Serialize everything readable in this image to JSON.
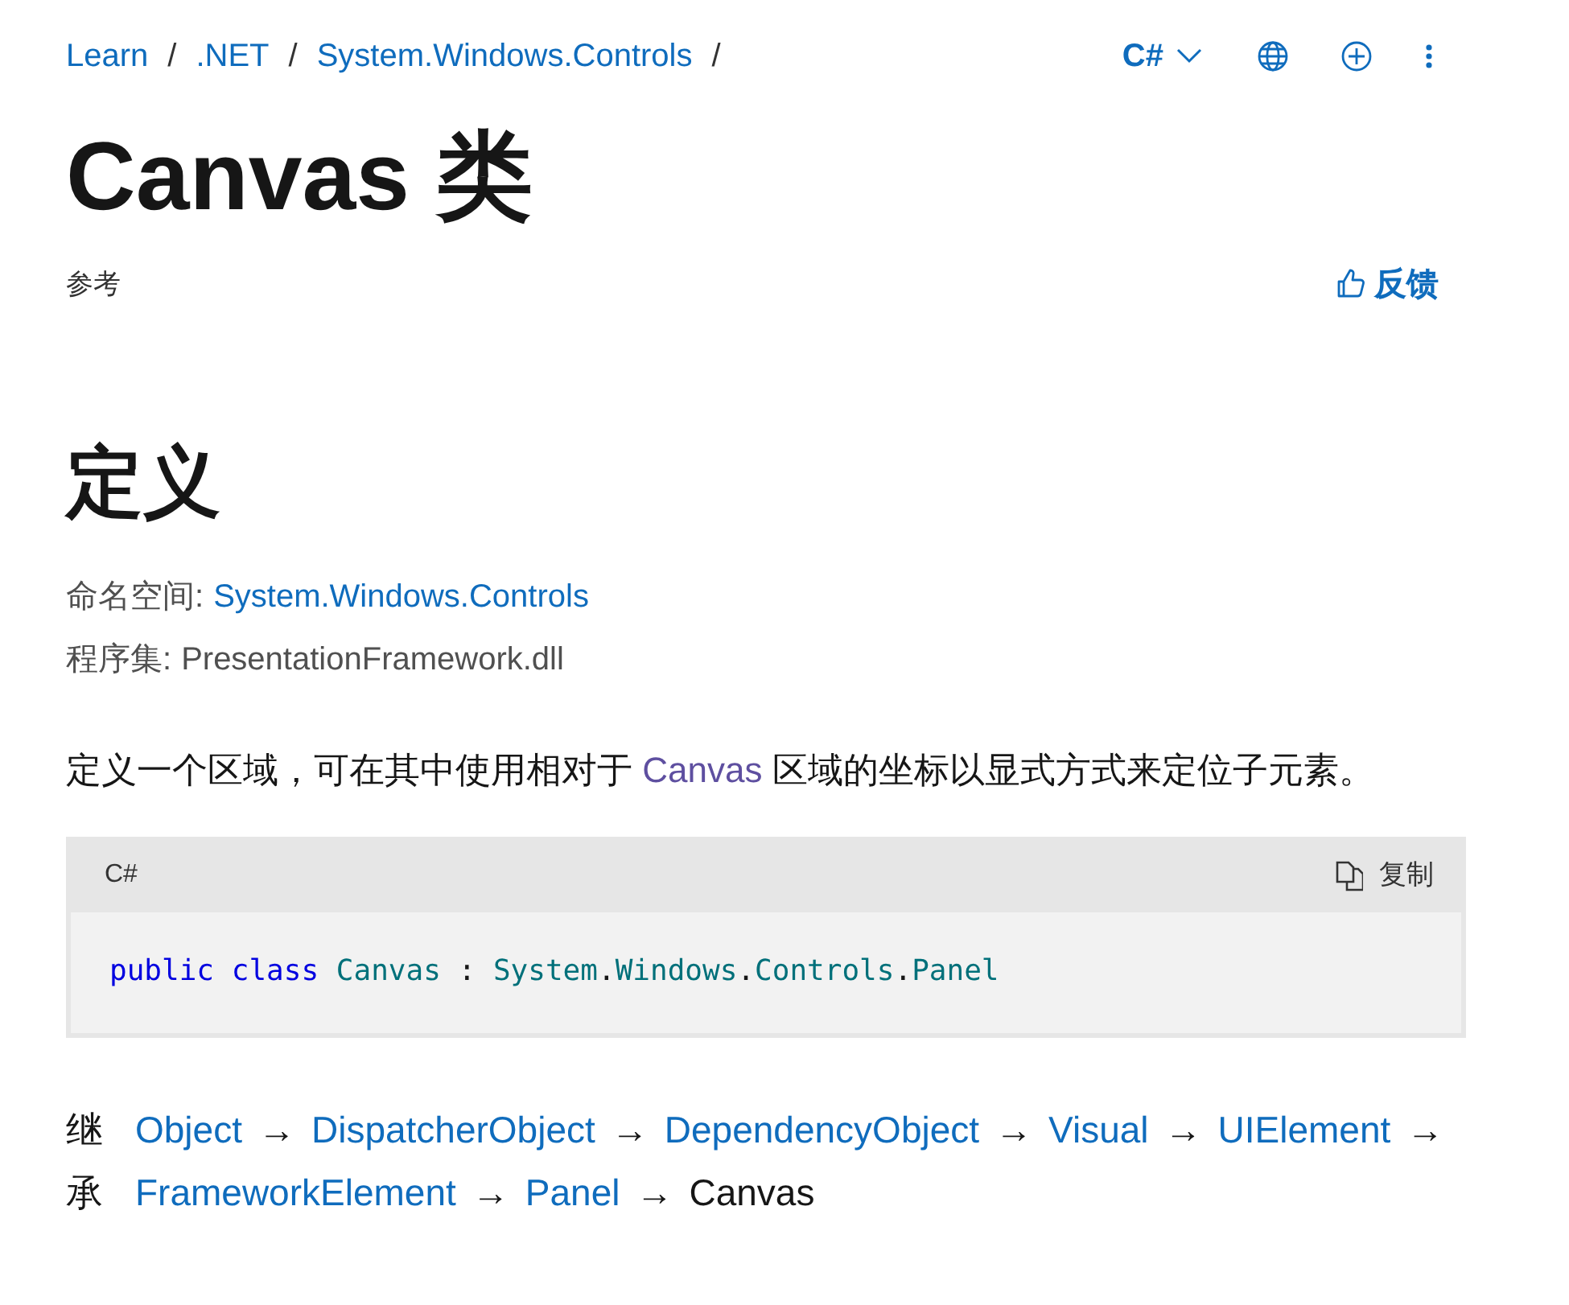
{
  "breadcrumbs": [
    {
      "label": "Learn"
    },
    {
      "label": ".NET"
    },
    {
      "label": "System.Windows.Controls"
    }
  ],
  "breadcrumb_separator": "/",
  "toolbar": {
    "language": "C#"
  },
  "title": "Canvas 类",
  "subtitle": "参考",
  "feedback": "反馈",
  "heading": "定义",
  "meta": [
    {
      "label": "命名空间:",
      "value": "System.Windows.Controls",
      "kind": "link"
    },
    {
      "label": "程序集:",
      "value": "PresentationFramework.dll",
      "kind": "text"
    }
  ],
  "description": [
    {
      "text": "定义一个区域，可在其中使用相对于 ",
      "kind": "text"
    },
    {
      "text": "Canvas",
      "kind": "link"
    },
    {
      "text": " 区域的坐标以显式方式来定位子元素。",
      "kind": "text"
    }
  ],
  "code": {
    "language": "C#",
    "copy": "复制",
    "tokens": [
      {
        "text": "public ",
        "kind": "keyword"
      },
      {
        "text": "class ",
        "kind": "keyword"
      },
      {
        "text": "Canvas",
        "kind": "type"
      },
      {
        "text": " : ",
        "kind": "plain"
      },
      {
        "text": "System",
        "kind": "type"
      },
      {
        "text": ".",
        "kind": "plain"
      },
      {
        "text": "Windows",
        "kind": "type"
      },
      {
        "text": ".",
        "kind": "plain"
      },
      {
        "text": "Controls",
        "kind": "type"
      },
      {
        "text": ".",
        "kind": "plain"
      },
      {
        "text": "Panel",
        "kind": "type"
      }
    ]
  },
  "inheritance": {
    "label": "继承",
    "chain": [
      {
        "text": "Object",
        "kind": "link"
      },
      {
        "text": "→",
        "kind": "arrow"
      },
      {
        "text": "DispatcherObject",
        "kind": "link"
      },
      {
        "text": "→",
        "kind": "arrow"
      },
      {
        "text": "DependencyObject",
        "kind": "link"
      },
      {
        "text": "→",
        "kind": "arrow"
      },
      {
        "text": "Visual",
        "kind": "link"
      },
      {
        "text": "→",
        "kind": "arrow"
      },
      {
        "text": "UIElement",
        "kind": "link"
      },
      {
        "text": "→",
        "kind": "arrow"
      },
      {
        "text": "FrameworkElement",
        "kind": "link"
      },
      {
        "text": "→",
        "kind": "arrow"
      },
      {
        "text": "Panel",
        "kind": "link"
      },
      {
        "text": "→",
        "kind": "arrow"
      },
      {
        "text": "Canvas",
        "kind": "current"
      }
    ]
  }
}
